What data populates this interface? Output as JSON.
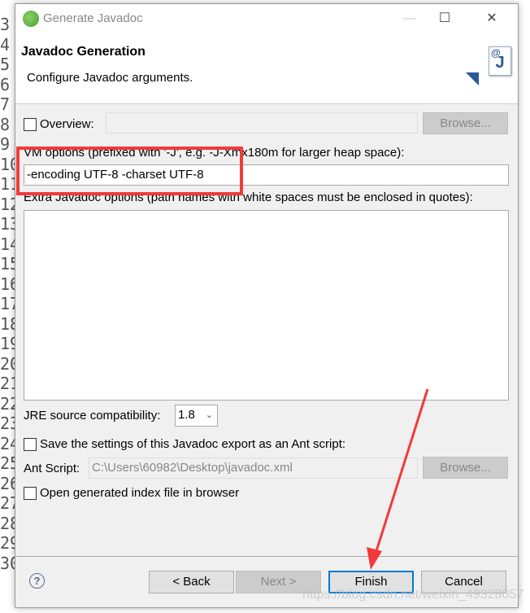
{
  "background_editor": {
    "line_numbers": [
      "3",
      "4",
      "5",
      "6",
      "7",
      "8",
      "9",
      "10",
      "11",
      "12",
      "13",
      "14",
      "15",
      "16",
      "17",
      "18",
      "19",
      "20",
      "21",
      "22",
      "23",
      "24",
      "25",
      "26",
      "27",
      "28",
      "29",
      "30"
    ]
  },
  "window": {
    "title": "Generate Javadoc",
    "minimize": "—",
    "maximize": "☐",
    "close": "✕"
  },
  "header": {
    "title": "Javadoc Generation",
    "description": "Configure Javadoc arguments."
  },
  "overview": {
    "label": "Overview:",
    "checked": false,
    "value": "",
    "browse": "Browse..."
  },
  "vm_options": {
    "label": "VM options (prefixed with '-J', e.g. -J-Xmx180m for larger heap space):",
    "value": "-encoding UTF-8 -charset UTF-8"
  },
  "extra_options": {
    "label": "Extra Javadoc options (path names with white spaces must be enclosed in quotes):",
    "value": ""
  },
  "jre": {
    "label": "JRE source compatibility:",
    "value": "1.8"
  },
  "save_ant": {
    "label": "Save the settings of this Javadoc export as an Ant script:",
    "checked": false
  },
  "ant_script": {
    "label": "Ant Script:",
    "value": "C:\\Users\\60982\\Desktop\\javadoc.xml",
    "browse": "Browse..."
  },
  "open_browser": {
    "label": "Open generated index file in browser",
    "checked": false
  },
  "buttons": {
    "help": "?",
    "back": "< Back",
    "next": "Next >",
    "finish": "Finish",
    "cancel": "Cancel"
  },
  "watermark": "https://blog.csdn.net/weixin_49328057",
  "colors": {
    "annotation": "#f23a3a",
    "focus": "#0078d7"
  }
}
